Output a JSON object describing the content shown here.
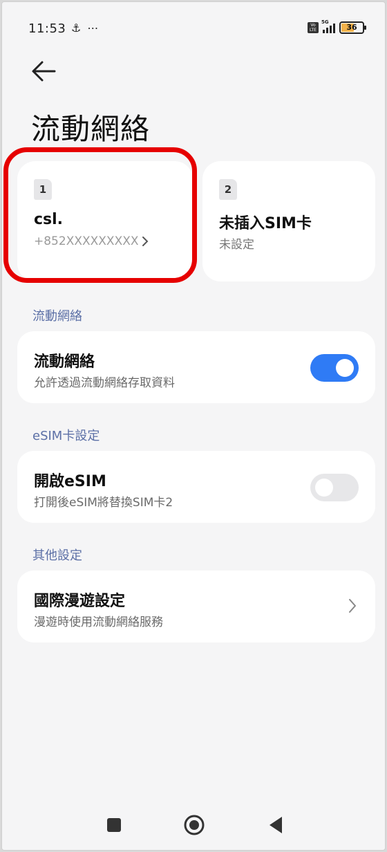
{
  "status_bar": {
    "time": "11:53",
    "left_icons": "⚓ ⋯",
    "network": "5G",
    "battery": "36"
  },
  "page": {
    "title": "流動網絡"
  },
  "sims": [
    {
      "slot": "1",
      "name": "csl.",
      "number": "+852XXXXXXXXX",
      "highlighted": true
    },
    {
      "slot": "2",
      "name": "未插入SIM卡",
      "number": "未設定"
    }
  ],
  "sections": {
    "mobile_network": {
      "label": "流動網絡",
      "item": {
        "title": "流動網絡",
        "subtitle": "允許透過流動網絡存取資料",
        "toggle": "on"
      }
    },
    "esim": {
      "label": "eSIM卡設定",
      "item": {
        "title": "開啟eSIM",
        "subtitle": "打開後eSIM將替換SIM卡2",
        "toggle": "off"
      }
    },
    "other": {
      "label": "其他設定",
      "item": {
        "title": "國際漫遊設定",
        "subtitle": "漫遊時使用流動網絡服務"
      }
    }
  },
  "colors": {
    "accent": "#2f7bf5",
    "highlight": "#e60000",
    "section_label": "#5b6fa6"
  },
  "icons": [
    "back-arrow-icon",
    "chevron-right-icon",
    "recents-square-icon",
    "home-circle-icon",
    "back-triangle-icon"
  ]
}
